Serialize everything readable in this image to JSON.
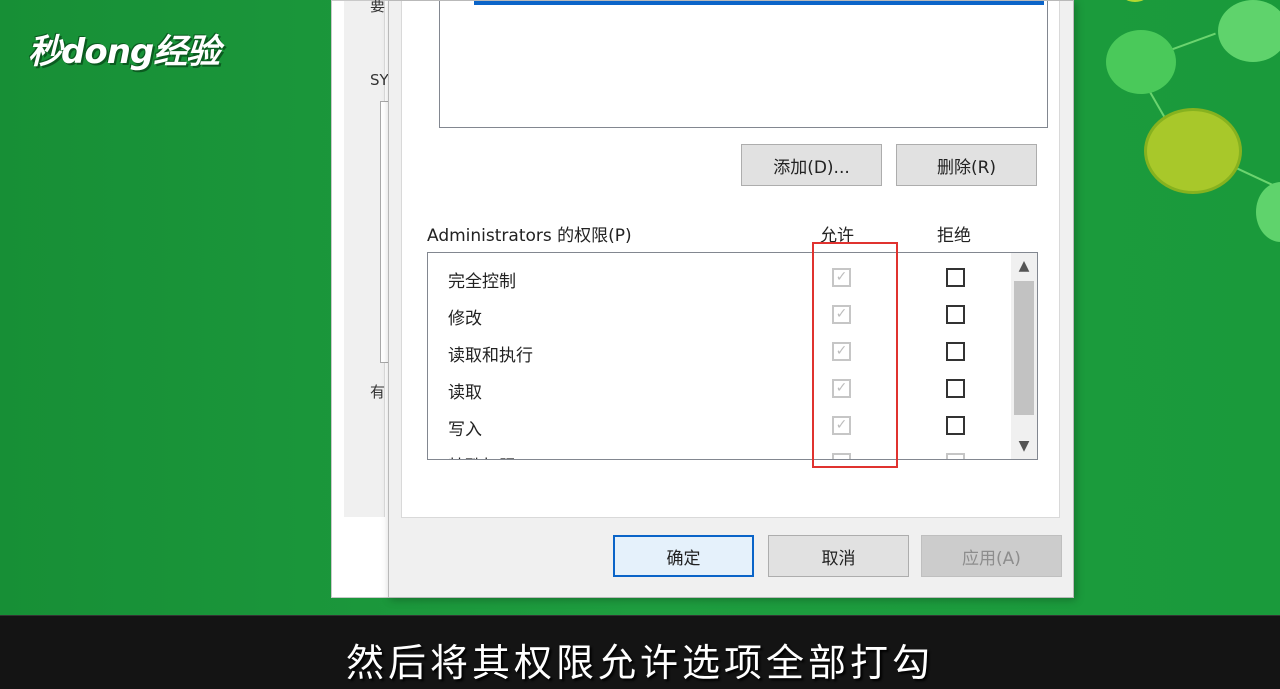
{
  "watermark": {
    "logo_text": "秒dong经验"
  },
  "background_dialog": {
    "fragments": [
      "要",
      "SY",
      "有"
    ]
  },
  "dialog": {
    "add_button": "添加(D)...",
    "remove_button": "删除(R)",
    "permissions_label": "Administrators 的权限(P)",
    "allow_header": "允许",
    "deny_header": "拒绝",
    "permissions": [
      {
        "name": "完全控制",
        "allow": true,
        "deny": false
      },
      {
        "name": "修改",
        "allow": true,
        "deny": false
      },
      {
        "name": "读取和执行",
        "allow": true,
        "deny": false
      },
      {
        "name": "读取",
        "allow": true,
        "deny": false
      },
      {
        "name": "写入",
        "allow": true,
        "deny": false
      },
      {
        "name": "特殊权限",
        "allow": false,
        "deny": false
      }
    ],
    "ok_button": "确定",
    "cancel_button": "取消",
    "apply_button": "应用(A)"
  },
  "caption": {
    "text": "然后将其权限允许选项全部打勾"
  },
  "colors": {
    "background": "#1c9a3c",
    "highlight_box": "#e0322f",
    "selection": "#0b64c8"
  }
}
